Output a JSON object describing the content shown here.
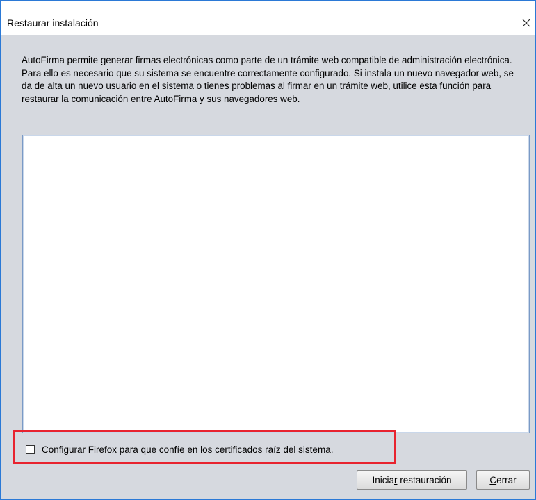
{
  "window": {
    "title": "Restaurar instalación",
    "close_icon": "close-icon"
  },
  "description": "AutoFirma permite generar firmas electrónicas como parte de un trámite web compatible de administración electrónica. Para ello es necesario que su sistema se encuentre correctamente configurado. Si instala un nuevo navegador web, se da de alta un nuevo usuario en el sistema o tienes problemas al firmar en un trámite web, utilice esta función para restaurar la comunicación entre AutoFirma y sus navegadores web.",
  "log_area": {
    "value": ""
  },
  "checkbox": {
    "label": "Configurar Firefox para que confíe en los certificados raíz del sistema.",
    "checked": false
  },
  "buttons": {
    "start": {
      "pre": "Inicia",
      "mnemonic": "r",
      "post": " restauración"
    },
    "close": {
      "pre": "",
      "mnemonic": "C",
      "post": "errar"
    }
  },
  "colors": {
    "highlight": "#e8232f",
    "window_border": "#2b79d6",
    "dialog_bg": "#d6d9df"
  }
}
